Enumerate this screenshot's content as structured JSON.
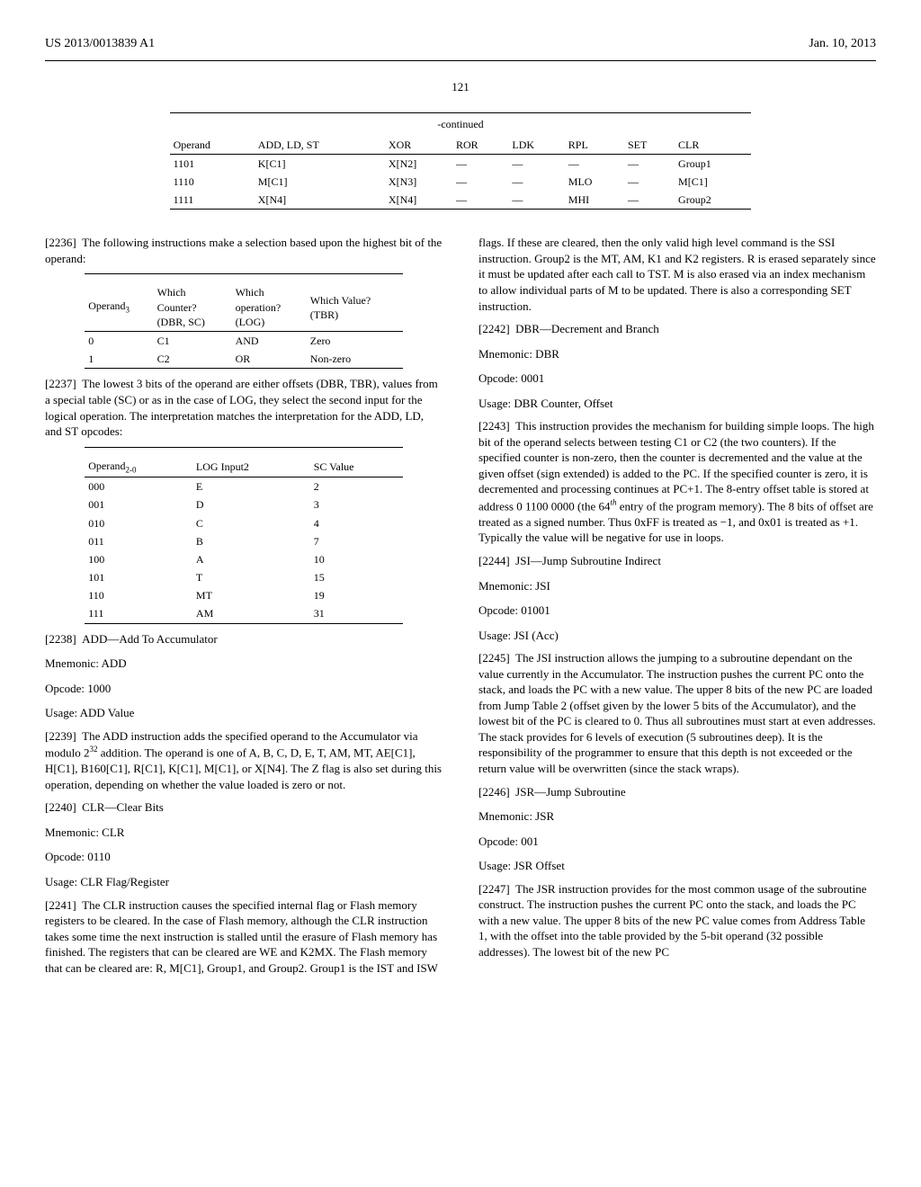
{
  "header": {
    "pubnum": "US 2013/0013839 A1",
    "date": "Jan. 10, 2013"
  },
  "pagenum": "121",
  "table_cont": {
    "title": "-continued",
    "headers": [
      "Operand",
      "ADD, LD, ST",
      "XOR",
      "ROR",
      "LDK",
      "RPL",
      "SET",
      "CLR"
    ],
    "rows": [
      [
        "1101",
        "K[C1]",
        "X[N2]",
        "—",
        "—",
        "—",
        "—",
        "Group1"
      ],
      [
        "1110",
        "M[C1]",
        "X[N3]",
        "—",
        "—",
        "MLO",
        "—",
        "M[C1]"
      ],
      [
        "1111",
        "X[N4]",
        "X[N4]",
        "—",
        "—",
        "MHI",
        "—",
        "Group2"
      ]
    ]
  },
  "para2236": "The following instructions make a selection based upon the highest bit of the operand:",
  "table2": {
    "headers": [
      "Operand₃",
      "Which\nCounter?\n(DBR, SC)",
      "Which\noperation?\n(LOG)",
      "Which Value?\n(TBR)"
    ],
    "h0": "Operand",
    "h0sub": "3",
    "h1a": "Which",
    "h1b": "Counter?",
    "h1c": "(DBR, SC)",
    "h2a": "Which",
    "h2b": "operation?",
    "h2c": "(LOG)",
    "h3a": "Which Value?",
    "h3b": "(TBR)",
    "rows": [
      [
        "0",
        "C1",
        "AND",
        "Zero"
      ],
      [
        "1",
        "C2",
        "OR",
        "Non-zero"
      ]
    ]
  },
  "para2237": "The lowest 3 bits of the operand are either offsets (DBR, TBR), values from a special table (SC) or as in the case of LOG, they select the second input for the logical operation. The interpretation matches the interpretation for the ADD, LD, and ST opcodes:",
  "table3": {
    "h0": "Operand",
    "h0sub": "2-0",
    "h1": "LOG Input2",
    "h2": "SC Value",
    "rows": [
      [
        "000",
        "E",
        "2"
      ],
      [
        "001",
        "D",
        "3"
      ],
      [
        "010",
        "C",
        "4"
      ],
      [
        "011",
        "B",
        "7"
      ],
      [
        "100",
        "A",
        "10"
      ],
      [
        "101",
        "T",
        "15"
      ],
      [
        "110",
        "MT",
        "19"
      ],
      [
        "111",
        "AM",
        "31"
      ]
    ]
  },
  "p2238_label": "[2238]",
  "p2238": "ADD—Add To Accumulator",
  "add": {
    "mnem": "Mnemonic: ADD",
    "opcode": "Opcode: 1000",
    "usage": "Usage: ADD Value"
  },
  "p2239_label": "[2239]",
  "p2239a": "The ADD instruction adds the specified operand to the Accumulator via modulo 2",
  "p2239exp": "32",
  "p2239b": " addition. The operand is one of A, B, C, D, E, T, AM, MT, AE[C1], H[C1], B160[C1], R[C1], K[C1], M[C1], or X[N4]. The Z flag is also set during this operation, depending on whether the value loaded is zero or not.",
  "p2240_label": "[2240]",
  "p2240": "CLR—Clear Bits",
  "clr": {
    "mnem": "Mnemonic: CLR",
    "opcode": "Opcode: 0110",
    "usage": "Usage: CLR Flag/Register"
  },
  "p2241_label": "[2241]",
  "p2241": "The CLR instruction causes the specified internal flag or Flash memory registers to be cleared. In the case of Flash memory, although the CLR instruction takes some time the next instruction is stalled until the erasure of Flash memory has finished. The registers that can be cleared are WE and K2MX. The Flash memory that can be cleared are: R, M[C1], Group1, and Group2. Group1 is the IST and ISW",
  "right_top": "flags. If these are cleared, then the only valid high level command is the SSI instruction. Group2 is the MT, AM, K1 and K2 registers. R is erased separately since it must be updated after each call to TST. M is also erased via an index mechanism to allow individual parts of M to be updated. There is also a corresponding SET instruction.",
  "p2242_label": "[2242]",
  "p2242": "DBR—Decrement and Branch",
  "dbr": {
    "mnem": "Mnemonic: DBR",
    "opcode": "Opcode: 0001",
    "usage": "Usage: DBR Counter, Offset"
  },
  "p2243_label": "[2243]",
  "p2243a": "This instruction provides the mechanism for building simple loops. The high bit of the operand selects between testing C1 or C2 (the two counters). If the specified counter is non-zero, then the counter is decremented and the value at the given offset (sign extended) is added to the PC. If the specified counter is zero, it is decremented and processing continues at PC+1. The 8-entry offset table is stored at address 0 1100 0000 (the 64",
  "p2243th": "th",
  "p2243b": " entry of the program memory). The 8 bits of offset are treated as a signed number. Thus 0xFF is treated as −1, and 0x01 is treated as +1. Typically the value will be negative for use in loops.",
  "p2244_label": "[2244]",
  "p2244": "JSI—Jump Subroutine Indirect",
  "jsi": {
    "mnem": "Mnemonic: JSI",
    "opcode": "Opcode: 01001",
    "usage": "Usage: JSI (Acc)"
  },
  "p2245_label": "[2245]",
  "p2245": "The JSI instruction allows the jumping to a subroutine dependant on the value currently in the Accumulator. The instruction pushes the current PC onto the stack, and loads the PC with a new value. The upper 8 bits of the new PC are loaded from Jump Table 2 (offset given by the lower 5 bits of the Accumulator), and the lowest bit of the PC is cleared to 0. Thus all subroutines must start at even addresses. The stack provides for 6 levels of execution (5 subroutines deep). It is the responsibility of the programmer to ensure that this depth is not exceeded or the return value will be overwritten (since the stack wraps).",
  "p2246_label": "[2246]",
  "p2246": "JSR—Jump Subroutine",
  "jsr": {
    "mnem": "Mnemonic: JSR",
    "opcode": "Opcode: 001",
    "usage": "Usage: JSR Offset"
  },
  "p2247_label": "[2247]",
  "p2247": "The JSR instruction provides for the most common usage of the subroutine construct. The instruction pushes the current PC onto the stack, and loads the PC with a new value. The upper 8 bits of the new PC value comes from Address Table 1, with the offset into the table provided by the 5-bit operand (32 possible addresses). The lowest bit of the new PC"
}
